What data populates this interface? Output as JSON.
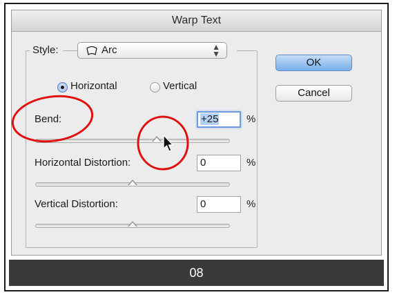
{
  "dialog": {
    "title": "Warp Text",
    "style_label": "Style:",
    "style_value": "Arc",
    "style_icon": "arc-warp-icon",
    "orientation": {
      "options": [
        "Horizontal",
        "Vertical"
      ],
      "selected": "Horizontal"
    },
    "bend": {
      "label": "Bend:",
      "value": "+25",
      "unit": "%",
      "slider_fraction": 0.625
    },
    "horizontal_distortion": {
      "label": "Horizontal Distortion:",
      "value": "0",
      "unit": "%",
      "slider_fraction": 0.5
    },
    "vertical_distortion": {
      "label": "Vertical Distortion:",
      "value": "0",
      "unit": "%",
      "slider_fraction": 0.5
    },
    "ok_label": "OK",
    "cancel_label": "Cancel"
  },
  "annotations": {
    "highlight_color": "#e01010"
  },
  "caption": {
    "number": "08"
  }
}
